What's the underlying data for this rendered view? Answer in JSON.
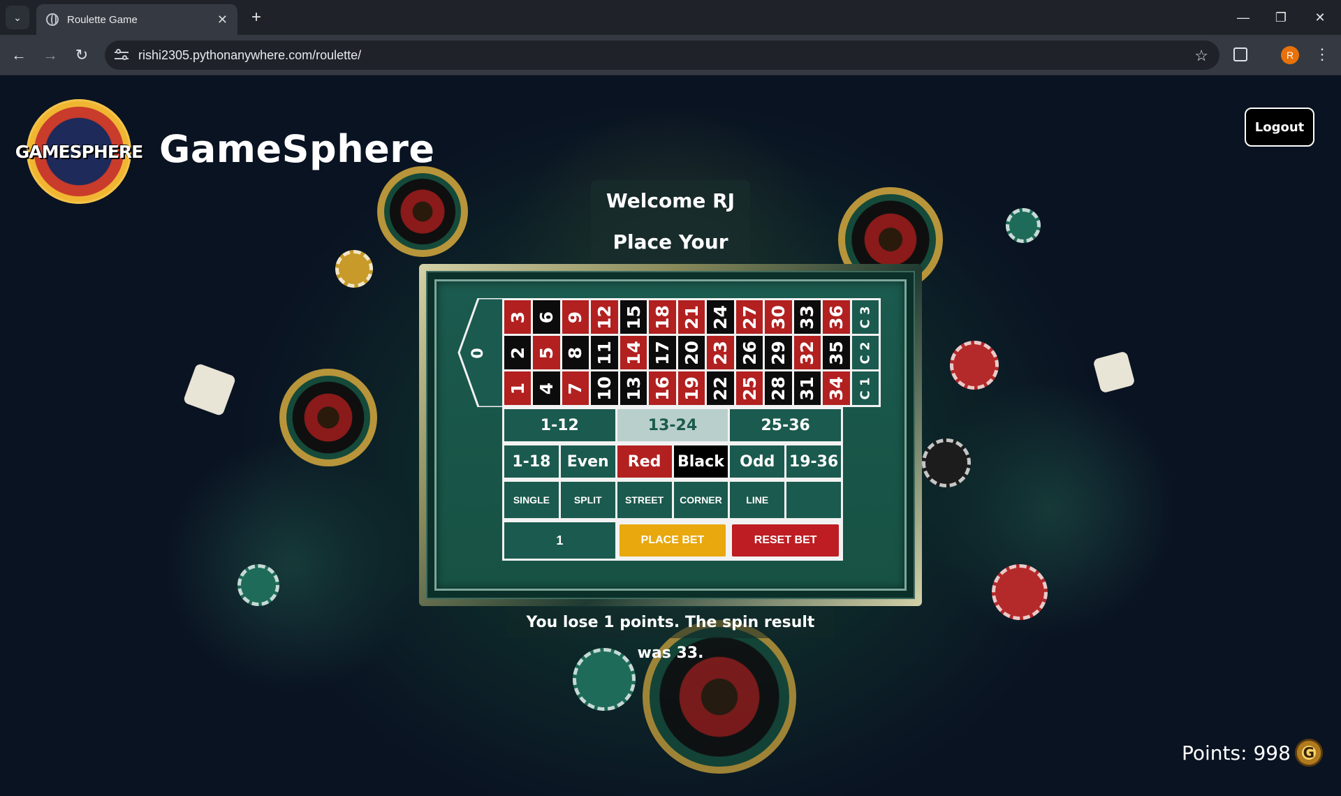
{
  "browser": {
    "tab_title": "Roulette Game",
    "url": "rishi2305.pythonanywhere.com/roulette/",
    "profile_initial": "R"
  },
  "site": {
    "logo_text": "GAMESPHERE",
    "brand": "GameSphere",
    "logout_label": "Logout"
  },
  "game": {
    "welcome": "Welcome RJ",
    "prompt": "Place Your Bet",
    "zero": "0",
    "numbers_row_top": [
      "3",
      "6",
      "9",
      "12",
      "15",
      "18",
      "21",
      "24",
      "27",
      "30",
      "33",
      "36"
    ],
    "numbers_row_mid": [
      "2",
      "5",
      "8",
      "11",
      "14",
      "17",
      "20",
      "23",
      "26",
      "29",
      "32",
      "35"
    ],
    "numbers_row_bot": [
      "1",
      "4",
      "7",
      "10",
      "13",
      "16",
      "19",
      "22",
      "25",
      "28",
      "31",
      "34"
    ],
    "columns": [
      "C 3",
      "C 2",
      "C 1"
    ],
    "dozens": [
      "1-12",
      "13-24",
      "25-36"
    ],
    "outside": [
      "1-18",
      "Even",
      "Red",
      "Black",
      "Odd",
      "19-36"
    ],
    "bet_types": [
      "SINGLE",
      "SPLIT",
      "STREET",
      "CORNER",
      "LINE",
      ""
    ],
    "bet_amount": "1",
    "place_bet_label": "PLACE BET",
    "reset_bet_label": "RESET BET",
    "result_message": "You lose 1 points. The spin result was 33.",
    "points_label": "Points: 998",
    "coin_symbol": "G"
  },
  "colors": {
    "felt": "#1b5a4e",
    "red": "#b22020",
    "black": "#0c0c0c",
    "place_bet": "#e8a80e",
    "reset_bet": "#bd1d23"
  }
}
